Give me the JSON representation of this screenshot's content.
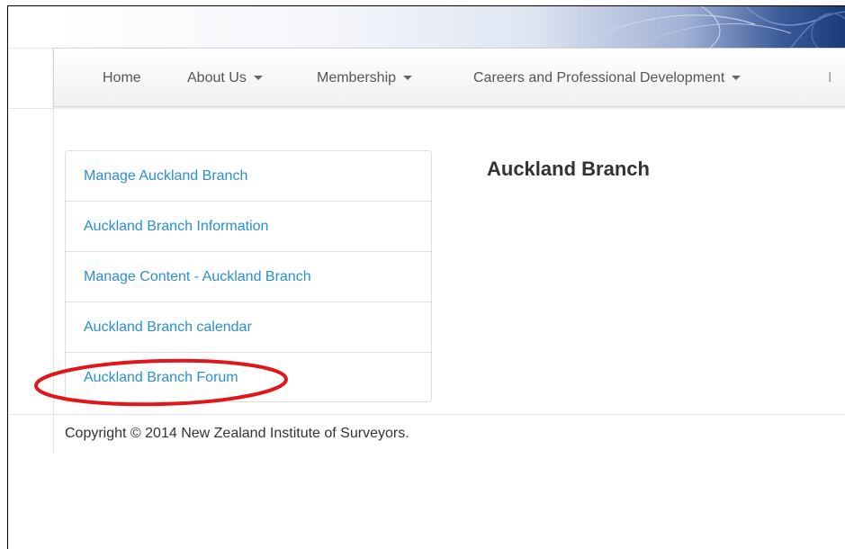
{
  "nav": {
    "home": "Home",
    "about_us": "About Us",
    "membership": "Membership",
    "careers": "Careers and Professional Development"
  },
  "sidebar": {
    "items": [
      {
        "label": "Manage Auckland Branch"
      },
      {
        "label": "Auckland Branch Information"
      },
      {
        "label": "Manage Content - Auckland Branch"
      },
      {
        "label": "Auckland Branch calendar"
      },
      {
        "label": "Auckland Branch Forum"
      }
    ]
  },
  "main": {
    "title": "Auckland Branch"
  },
  "footer": {
    "copyright": "Copyright © 2014 New Zealand Institute of Surveyors."
  },
  "colors": {
    "link": "#2a8fcf",
    "highlight_ring": "#e0161b",
    "nav_text": "#555555"
  },
  "icons": [
    "caret-down-icon"
  ]
}
